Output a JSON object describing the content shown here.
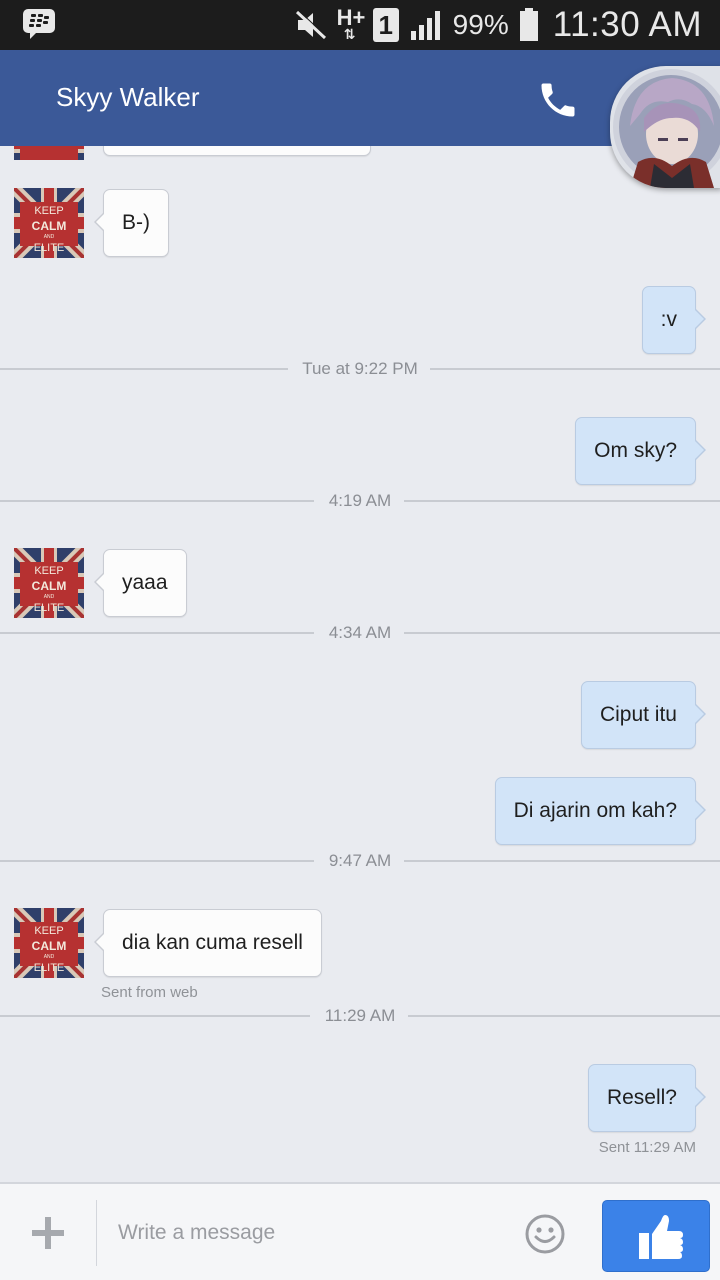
{
  "status_bar": {
    "battery_percent": "99%",
    "time": "11:30 AM",
    "network_type": "H+",
    "sim_slot": "1"
  },
  "header": {
    "contact_name": "Skyy Walker"
  },
  "messages": [
    {
      "side": "left",
      "text": "B-)"
    },
    {
      "side": "right",
      "text": ":v"
    },
    {
      "side": "right",
      "text": "Om sky?"
    },
    {
      "side": "left",
      "text": "yaaa"
    },
    {
      "side": "right",
      "text": "Ciput itu"
    },
    {
      "side": "right",
      "text": "Di ajarin om kah?"
    },
    {
      "side": "left",
      "text": "dia kan cuma resell",
      "meta": "Sent from web"
    },
    {
      "side": "right",
      "text": "Resell?",
      "meta": "Sent 11:29 AM"
    }
  ],
  "dividers": [
    "Tue at 9:22 PM",
    "4:19 AM",
    "4:34 AM",
    "9:47 AM",
    "11:29 AM"
  ],
  "avatar_text": {
    "line1": "KEEP",
    "line2": "CALM",
    "line3": "AND",
    "line4": "ELITE"
  },
  "composer": {
    "placeholder": "Write a message"
  },
  "colors": {
    "header": "#3b5998",
    "sent_bubble": "#d2e4f8",
    "received_bubble": "#fcfcfc",
    "like_button": "#3b82e8"
  },
  "icons": {
    "call": "phone-icon",
    "attach": "plus-icon",
    "emoji": "smiley-icon",
    "send": "thumbs-up-icon"
  }
}
